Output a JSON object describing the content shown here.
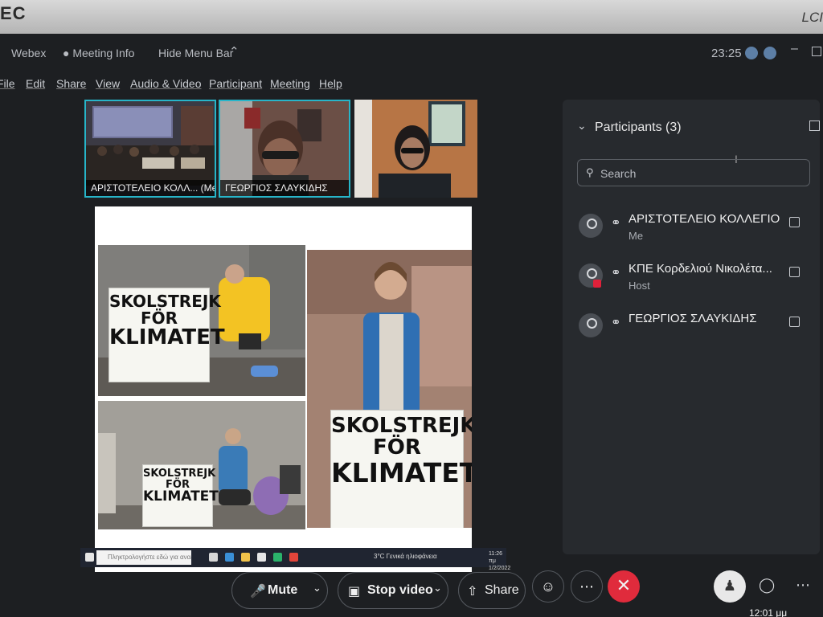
{
  "monitor": {
    "brand": "EC",
    "label": "LCI"
  },
  "titlebar": {
    "app": "Webex",
    "meeting_info": "Meeting Info",
    "hide_menu_bar": "Hide Menu Bar",
    "clock": "23:25"
  },
  "menubar": [
    "File",
    "Edit",
    "Share",
    "View",
    "Audio & Video",
    "Participant",
    "Meeting",
    "Help"
  ],
  "thumbnails": [
    {
      "name": "ΑΡΙΣΤΟΤΕΛΕΙΟ ΚΟΛΛ...  (Me)"
    },
    {
      "name": "ΓΕΩΡΓΙΟΣ ΣΛΑΥΚΙΔΗΣ"
    }
  ],
  "shared_content": {
    "signs": [
      [
        "SKOLSTREJK",
        "FÖR",
        "KLIMATET"
      ],
      [
        "SKOLSTREJK",
        "FÖR",
        "KLIMATET"
      ],
      [
        "SKOLSTREJK",
        "FÖR",
        "KLIMATET"
      ]
    ],
    "taskbar": {
      "search_placeholder": "Πληκτρολογήστε εδώ για αναζήτηση",
      "weather": "3°C Γενικά ηλιοφάνεια",
      "time": "11:26 πμ",
      "date": "1/2/2022"
    }
  },
  "participants": {
    "title": "Participants (3)",
    "search_placeholder": "Search",
    "list": [
      {
        "name": "ΑΡΙΣΤΟΤΕΛΕΙΟ ΚΟΛΛΕΓΙΟ",
        "role": "Me"
      },
      {
        "name": "ΚΠΕ Κορδελιού Νικολέτα...",
        "role": "Host"
      },
      {
        "name": "ΓΕΩΡΓΙΟΣ ΣΛΑΥΚΙΔΗΣ",
        "role": ""
      }
    ]
  },
  "controls": {
    "mute": "Mute",
    "stop_video": "Stop video",
    "share": "Share"
  },
  "system_time": "12:01 μμ",
  "colors": {
    "active_border": "#27b5c9",
    "leave_button": "#e02b3c"
  }
}
